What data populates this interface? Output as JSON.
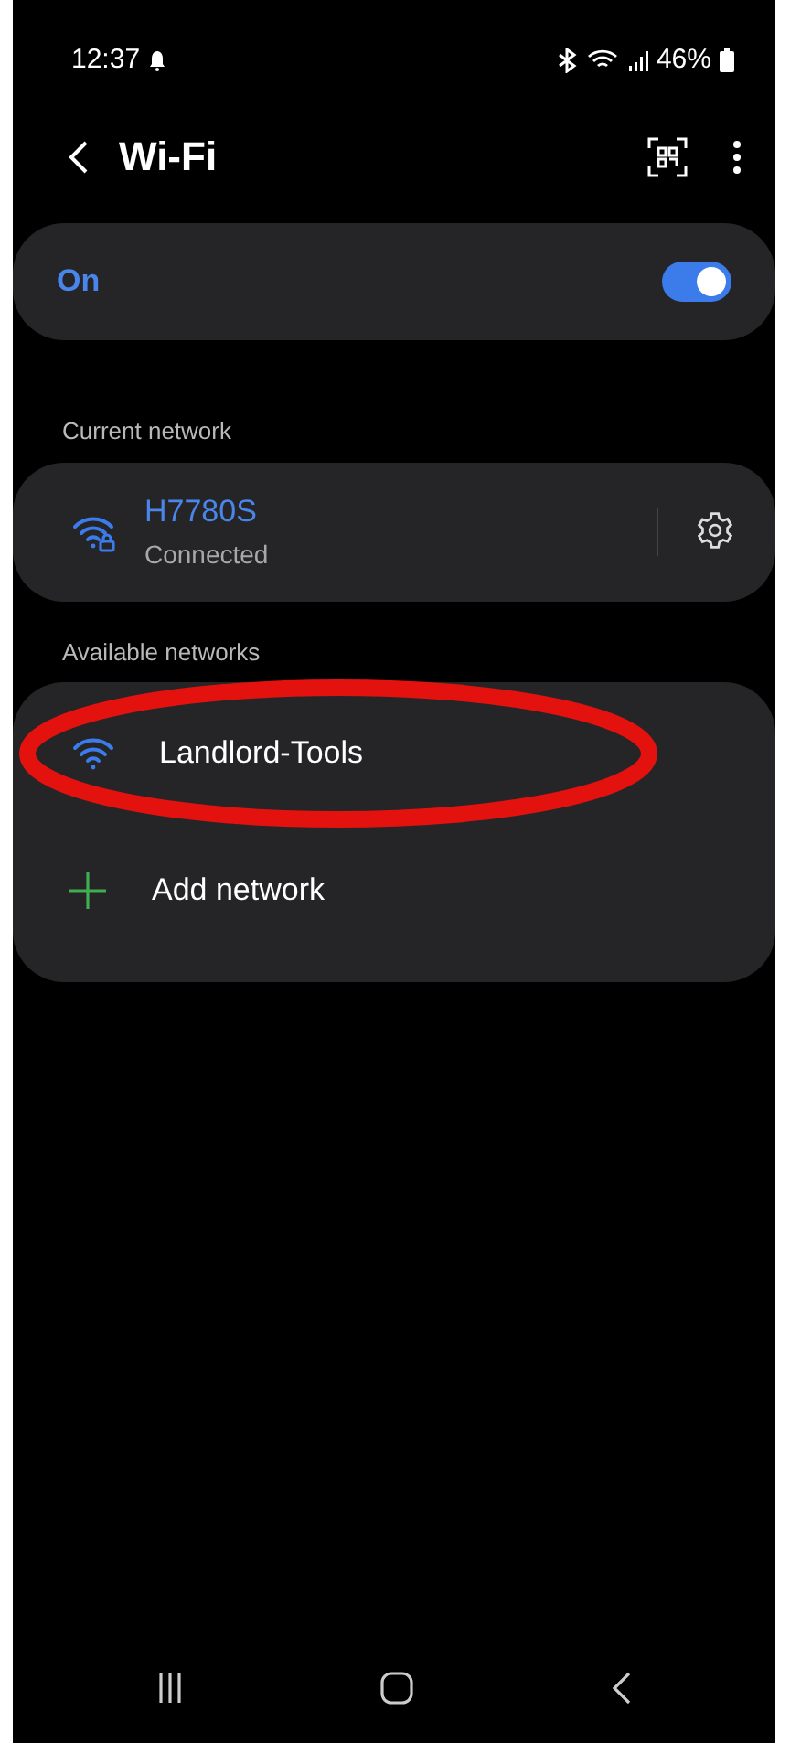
{
  "status_bar": {
    "time": "12:37",
    "battery": "46%"
  },
  "header": {
    "title": "Wi-Fi"
  },
  "wifi_switch": {
    "label": "On",
    "on": true
  },
  "current_network": {
    "heading": "Current network",
    "name": "H7780S",
    "status": "Connected",
    "locked": true
  },
  "available_networks": {
    "heading": "Available networks",
    "items": [
      {
        "name": "Landlord-Tools",
        "locked": false
      }
    ],
    "add_label": "Add network"
  }
}
